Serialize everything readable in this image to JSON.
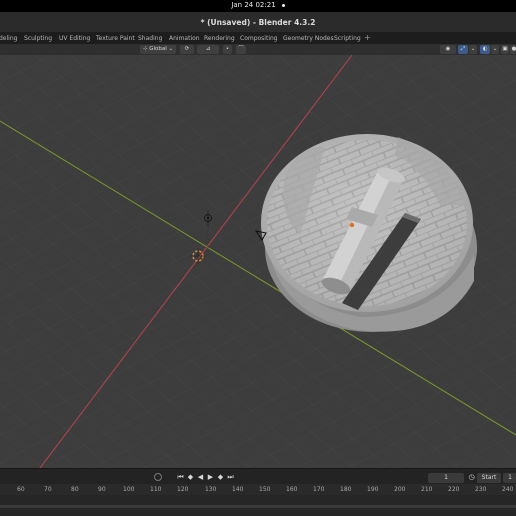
{
  "system": {
    "clock": "Jan 24  02:21"
  },
  "window": {
    "title": "* (Unsaved) - Blender 4.3.2"
  },
  "workspace_tabs": [
    "deling",
    "Sculpting",
    "UV Editing",
    "Texture Paint",
    "Shading",
    "Animation",
    "Rendering",
    "Compositing",
    "Geometry Nodes",
    "Scripting"
  ],
  "viewport_header": {
    "transform_orientation": "Global"
  },
  "timeline": {
    "current_frame": "1",
    "start_label": "Start",
    "start_value": "1",
    "ruler_ticks": [
      "60",
      "70",
      "80",
      "90",
      "100",
      "110",
      "120",
      "130",
      "140",
      "150",
      "160",
      "170",
      "180",
      "190",
      "200",
      "210",
      "220",
      "230",
      "240"
    ]
  },
  "colors": {
    "viewport_bg": "#3d3d3d",
    "x_axis": "#b8444a",
    "y_axis": "#7a9a2a",
    "selection_origin": "#e07020"
  },
  "icons": [
    "plus-icon",
    "play-icon",
    "jump-start-icon",
    "keyframe-prev-icon",
    "play-reverse-icon",
    "keyframe-next-icon",
    "jump-end-icon",
    "stopwatch-icon",
    "camera-icon",
    "light-icon",
    "3d-cursor-icon"
  ]
}
